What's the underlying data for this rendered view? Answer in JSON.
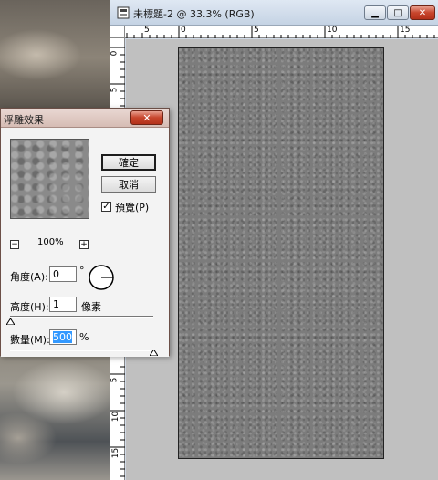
{
  "document": {
    "title": "未標題-2 @ 33.3% (RGB)",
    "ruler_top_ticks": [
      "5",
      "0",
      "5",
      "10",
      "15"
    ],
    "ruler_left_ticks": [
      "0",
      "5",
      "5",
      "10",
      "15"
    ]
  },
  "dialog": {
    "title": "浮雕效果",
    "ok_label": "確定",
    "cancel_label": "取消",
    "preview_label": "預覽(P)",
    "preview_checked": true,
    "zoom_minus": "−",
    "zoom_plus": "+",
    "zoom_value": "100%",
    "angle_label": "角度(A):",
    "angle_value": "0",
    "angle_unit": "°",
    "height_label": "高度(H):",
    "height_value": "1",
    "height_unit": "像素",
    "amount_label": "數量(M):",
    "amount_value": "500",
    "amount_unit": "%",
    "height_slider_fraction": 0.0,
    "amount_slider_fraction": 1.0
  },
  "colors": {
    "accent_close": "#c7452c",
    "selection": "#3399ff",
    "artboard": "#7c7c7c"
  },
  "icons": [
    "app-icon",
    "minimize-icon",
    "maximize-icon",
    "close-icon",
    "angle-dial-icon",
    "slider-thumb-icon"
  ]
}
